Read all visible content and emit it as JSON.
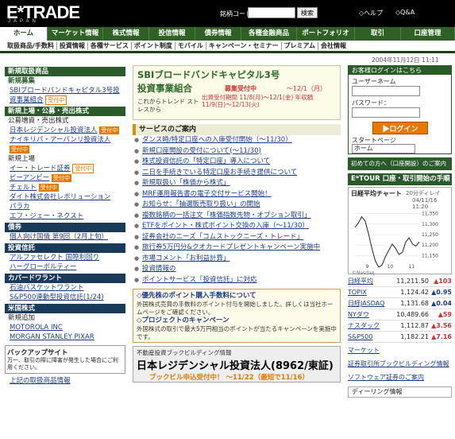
{
  "header": {
    "logo": "E*TRADE",
    "logo_sub": "JAPAN",
    "search_label": "銘柄コード：",
    "search_button": "検索",
    "help_link": "◇ヘルプ",
    "faq_link": "◇Q&A"
  },
  "tabs": [
    {
      "label": "ホーム"
    },
    {
      "label": "マーケット情報"
    },
    {
      "label": "株式情報"
    },
    {
      "label": "投信情報"
    },
    {
      "label": "債券情報"
    },
    {
      "label": "各種金融商品"
    },
    {
      "label": "ポートフォリオ"
    },
    {
      "label": "取引"
    },
    {
      "label": "口座管理"
    }
  ],
  "subnav": [
    {
      "label": "取扱商品/手数料"
    },
    {
      "label": "投資情報"
    },
    {
      "label": "各種サービス"
    },
    {
      "label": "ポイント制度"
    },
    {
      "label": "モバイル"
    },
    {
      "label": "キャンペーン・セミナー"
    },
    {
      "label": "プレミアム"
    },
    {
      "label": "会社情報"
    }
  ],
  "datetime": "2004年11月12日 11:11",
  "left": {
    "sec1": "新規取扱商品",
    "sec1_sub": "新規募集",
    "sec1_items": [
      {
        "text": "SBIブロードバンドキャピタル3号投資事業組合",
        "badge": "受付中"
      }
    ],
    "sec2": "新規上場・公募・売出株式",
    "sec2_label": "公募増資・売出株式",
    "sec2_items": [
      {
        "text": "日本レジデンシャル投資法人",
        "badge": "受付中"
      },
      {
        "text": "ナイキリバ・アーバンリ投資法人",
        "badge": "受付中"
      }
    ],
    "sec2_label2": "新規上場",
    "sec2_items2": [
      {
        "text": "イー・トレード証券",
        "badge": "受付中"
      },
      {
        "text": "ビーアンビー",
        "badge": "受付中"
      },
      {
        "text": "チェルト",
        "badge": "受付中"
      },
      {
        "text": "ダイト株式会社レボリューション",
        "badge": ""
      },
      {
        "text": "パラカ",
        "badge": ""
      },
      {
        "text": "エフ・ジェー・ネクスト",
        "badge": ""
      }
    ],
    "sec3": "債券",
    "sec3_items": [
      {
        "text": "個人向け国債 第9回（2月上旬）",
        "badge": ""
      }
    ],
    "sec4": "投資信託",
    "sec4_items": [
      {
        "text": "アルファセレクト 国際利回り",
        "badge": ""
      },
      {
        "text": "ハーグローボルティー",
        "badge": ""
      }
    ],
    "sec5": "カバードワラント",
    "sec5_items": [
      {
        "text": "石油バスケットワラント",
        "badge": ""
      },
      {
        "text": "S&P500連動型投資信託(1/24)",
        "badge": ""
      }
    ],
    "sec6": "米国株式",
    "sec6_label": "新規追加",
    "sec6_items": [
      {
        "text": "MOTOROLA INC",
        "badge": ""
      },
      {
        "text": "MORGAN STANLEY  PIXAR",
        "badge": ""
      }
    ],
    "backup_title": "バックアップサイト",
    "backup_text": "万一、取引の際に障害が発生した場合にご利用ください。",
    "bottom_link": "上記の取扱商品情報"
  },
  "center": {
    "banner1_title1": "SBIブロードバンドキャピタル3号",
    "banner1_title2": "投資事業組合",
    "banner1_status": "募集受付中",
    "banner1_period": "～12/1（月）",
    "banner1_left": "これからトレンド ストレスから",
    "banner1_right": "出資受付期間 11/8(月)～12/1(金) 年収額 11/9(日)～12/13(火)",
    "services_title": "サービスのご案内",
    "services": [
      {
        "text": "ダンス時/特定口座への入庫受付開始（～11/30）"
      },
      {
        "text": "新規口座開設の受付について(～11/30)"
      },
      {
        "text": "株式投資信託の「特定口座」導入について"
      },
      {
        "text": "二日を手続きでいる特定口座お手続き提供について"
      },
      {
        "text": "新規取扱い「株価から株式」"
      },
      {
        "text": "MRF運用報告書の電子交付サービス開始！"
      },
      {
        "text": "お知らせ：「抽選販売取り扱い」の開始"
      },
      {
        "text": "複数銘柄の一括注文「株価指数先物・オプション取引」"
      },
      {
        "text": "ETFをポイント・株式ポイント交換の入庫（～11/30）"
      },
      {
        "text": "証券会社のニーズ「コムストックニーズ・トレード」"
      },
      {
        "text": "旅行券5万円分&クオカードプレゼントキャンペーン実施中"
      },
      {
        "text": "市場コメント「お利益計算」"
      },
      {
        "text": "投資情報の"
      },
      {
        "text": "ポイントサービス「投資信託」に対応"
      }
    ],
    "info_h1": "◇優先株のポイント購入手数料について",
    "info_t1": "外国株式売買の手数料のポイント付与を開始しました。詳しくは当社ホームページをご確認ください。",
    "info_h2": "◇プロジェクトのキャンペーン",
    "info_t2": "外国株式の取引で最大5万円相当のポイントが当たるキャンペーンを実施中です。",
    "banner2_t1": "不動産投資ブックビルディング情報",
    "banner2_t2": "日本レジデンシャル投資法人(8962/東証)",
    "banner2_t3": "ブックビル申込受付中！ ～11/22（最短で11/16）"
  },
  "right": {
    "login_hdr": "お客様ログインはこちら",
    "user_label": "ユーザーネーム",
    "pass_label": "パスワード：",
    "login_button": "▶ログイン",
    "start_label": "スタートページ",
    "start_value": "ホーム",
    "btn1": "初めての方へ（口座開設）のご案内",
    "etour": "E*TOUR 口座・取引開始の手順",
    "chart_title": "日経平均チャート",
    "chart_sub": "20分ディレイ",
    "chart_date": "04/11/16 11:20",
    "chart_note": "©Nasdaq",
    "markets_link": "マーケット",
    "links": [
      {
        "text": "証券取引所ブックビルディング情報"
      },
      {
        "text": "ソフトウェア証券のご案内"
      }
    ],
    "bottom_btn": "ディーリング情報"
  },
  "indices": [
    {
      "name": "日経平均",
      "value": "11,211.50",
      "change": "▲103"
    },
    {
      "name": "TOPIX",
      "value": "1,124.42",
      "change": "▲0.95"
    },
    {
      "name": "日経JASDAQ",
      "value": "1,131.68",
      "change": "▲0.04"
    },
    {
      "name": "NYダウ",
      "value": "10,489.66",
      "change": "▲59"
    },
    {
      "name": "ナスダック",
      "value": "1,112.87",
      "change": "▲3.56"
    },
    {
      "name": "S&P500",
      "value": "1,182.21",
      "change": "▲7.16"
    }
  ],
  "chart_data": {
    "type": "line",
    "title": "日経平均チャート",
    "x": [
      "",
      "",
      "",
      "",
      "",
      "",
      "",
      "",
      "",
      "",
      "",
      "",
      "",
      "",
      "",
      "",
      "",
      "",
      "",
      ""
    ],
    "values": [
      11280,
      11300,
      11330,
      11310,
      11250,
      11180,
      11120,
      11090,
      11100,
      11140,
      11170,
      11200,
      11180,
      11150,
      11160,
      11210,
      11230,
      11200,
      11190,
      11210
    ],
    "yticks": [
      "11,350",
      "11,300",
      "11,250",
      "11,200",
      "11,150"
    ],
    "xticks": [
      "9",
      "10",
      "11"
    ],
    "ylim": [
      11120,
      11370
    ]
  }
}
